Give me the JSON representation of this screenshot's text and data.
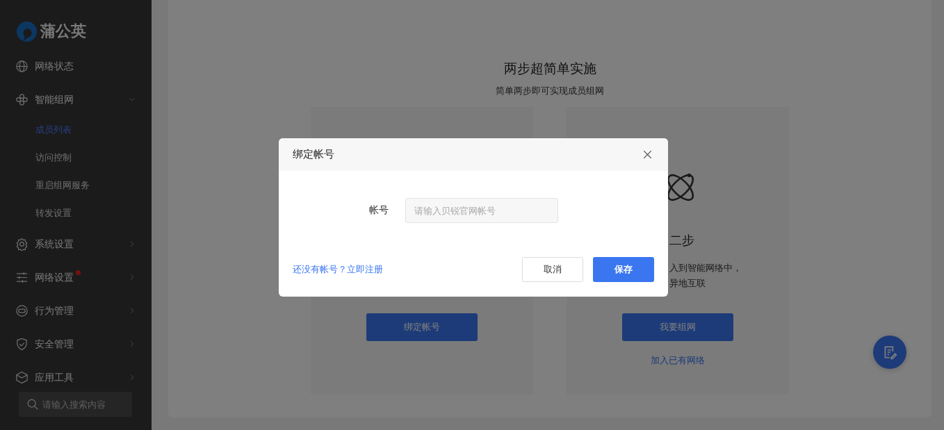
{
  "sidebar": {
    "logo": "蒲公英",
    "items": [
      {
        "label": "网络状态",
        "kind": "link"
      },
      {
        "label": "智能组网",
        "kind": "group",
        "expanded": true,
        "children": [
          {
            "label": "成员列表",
            "selected": true
          },
          {
            "label": "访问控制",
            "selected": false
          },
          {
            "label": "重启组网服务",
            "selected": false
          },
          {
            "label": "转发设置",
            "selected": false
          }
        ]
      },
      {
        "label": "系统设置",
        "kind": "group",
        "expanded": false
      },
      {
        "label": "网络设置",
        "kind": "group",
        "expanded": false,
        "dot": true
      },
      {
        "label": "行为管理",
        "kind": "group",
        "expanded": false
      },
      {
        "label": "安全管理",
        "kind": "group",
        "expanded": false
      },
      {
        "label": "应用工具",
        "kind": "group",
        "expanded": false
      }
    ],
    "search": {
      "placeholder": "请输入搜索内容"
    }
  },
  "main": {
    "title": "两步超简单实施",
    "subtitle": "简单两步即可实现成员组网",
    "steps": [
      {
        "button": "绑定帐号"
      },
      {
        "title": "二步",
        "lines": [
          "入到智能网络中，",
          "异地互联"
        ],
        "button": "我要组网",
        "link": "加入已有网络"
      }
    ]
  },
  "dialog": {
    "title": "绑定帐号",
    "field": {
      "label": "帐号",
      "placeholder": "请输入贝锐官网帐号"
    },
    "register_link": "还没有帐号？立即注册",
    "buttons": [
      {
        "label": "取消",
        "kind": "secondary"
      },
      {
        "label": "保存",
        "kind": "primary"
      }
    ]
  }
}
